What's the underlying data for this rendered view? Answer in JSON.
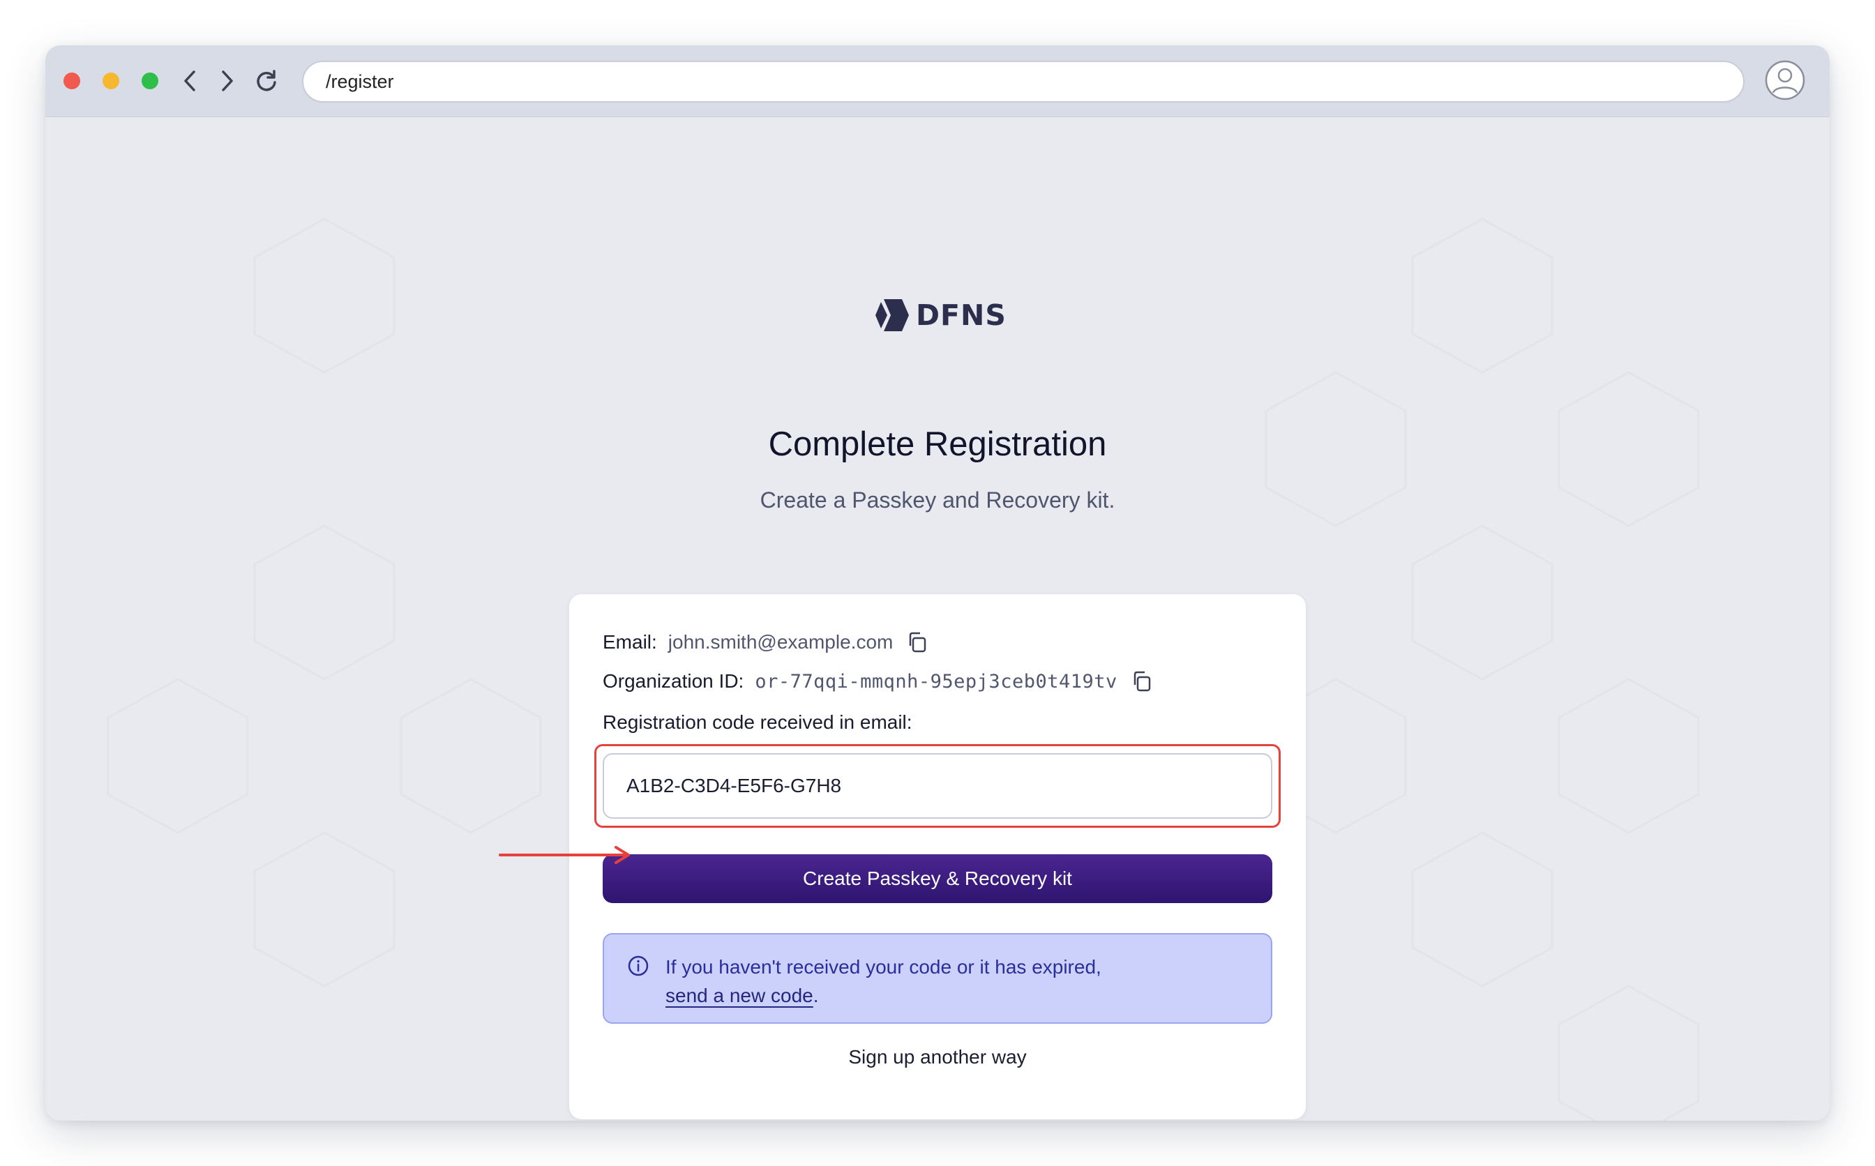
{
  "browser": {
    "url": "/register"
  },
  "brand": {
    "logo_text": "DFNS"
  },
  "page": {
    "title": "Complete Registration",
    "subtitle": "Create a Passkey and Recovery kit."
  },
  "form": {
    "email_label": "Email:",
    "email_value": "john.smith@example.com",
    "org_label": "Organization ID:",
    "org_value": "or-77qqi-mmqnh-95epj3ceb0t419tv",
    "code_label": "Registration code received in email:",
    "code_value": "A1B2-C3D4-E5F6-G7H8",
    "submit_label": "Create Passkey & Recovery kit"
  },
  "info_box": {
    "text": "If you haven't received your code or it has expired,",
    "link_text": "send a new code",
    "suffix": "."
  },
  "alt_action": {
    "label": "Sign up another way"
  },
  "colors": {
    "primary": "#3a1a80",
    "info_bg": "#ccd1fb",
    "highlight": "#e6423d"
  }
}
